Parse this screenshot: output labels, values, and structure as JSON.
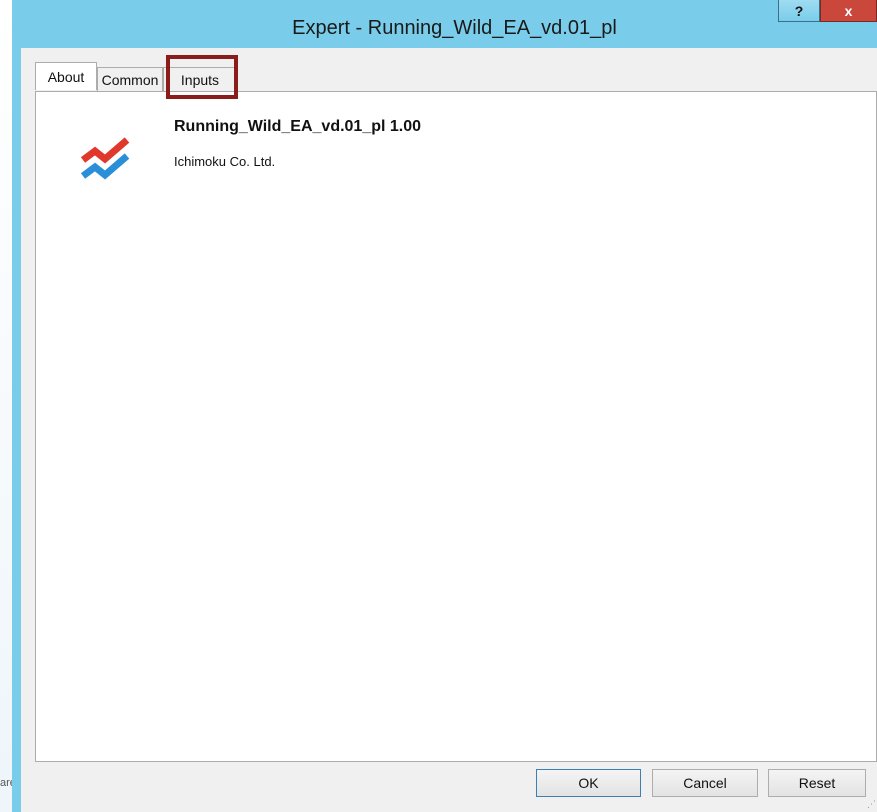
{
  "background": {
    "fragment_text": "are"
  },
  "window": {
    "title": "Expert - Running_Wild_EA_vd.01_pl",
    "help_label": "?",
    "close_label": "x"
  },
  "tabs": [
    {
      "label": "About",
      "active": true
    },
    {
      "label": "Common",
      "active": false
    },
    {
      "label": "Inputs",
      "active": false,
      "highlighted": true
    }
  ],
  "about": {
    "logo_icon": "chart-zigzag-icon",
    "product_name": "Running_Wild_EA_vd.01_pl 1.00",
    "company": "Ichimoku Co. Ltd."
  },
  "buttons": {
    "ok": "OK",
    "cancel": "Cancel",
    "reset": "Reset"
  },
  "colors": {
    "titlebar": "#79cdea",
    "close_button": "#c9473b",
    "highlight_box": "#8a1c1c",
    "logo_red": "#e0392b",
    "logo_blue": "#2a8fd8"
  }
}
